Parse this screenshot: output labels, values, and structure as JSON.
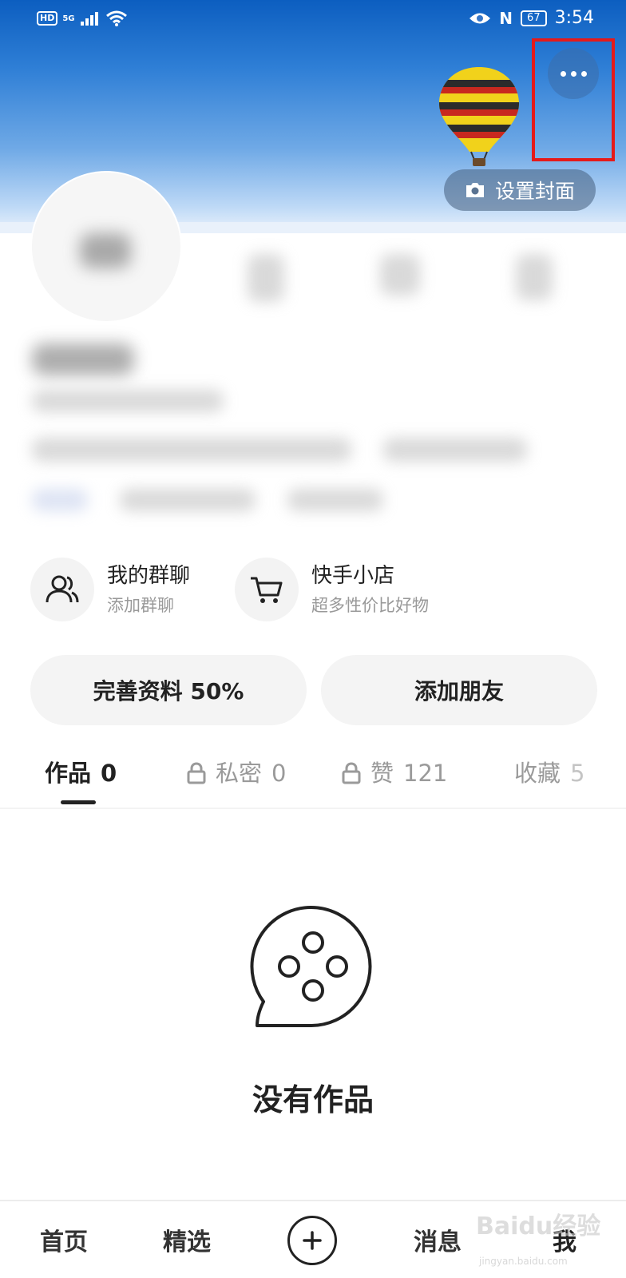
{
  "status_bar": {
    "network_hd": "HD",
    "network_5g": "5G",
    "battery": "67",
    "nfc": "N",
    "time": "3:54"
  },
  "cover": {
    "set_cover_label": "设置封面",
    "more_icon": "more-dots-icon",
    "camera_icon": "camera-icon"
  },
  "shortcuts": [
    {
      "title": "我的群聊",
      "subtitle": "添加群聊",
      "icon": "group-chat-icon"
    },
    {
      "title": "快手小店",
      "subtitle": "超多性价比好物",
      "icon": "shopping-cart-icon"
    }
  ],
  "actions": {
    "complete_profile": "完善资料 50%",
    "add_friends": "添加朋友"
  },
  "tabs": [
    {
      "label": "作品",
      "count": "0",
      "active": true,
      "locked": false
    },
    {
      "label": "私密",
      "count": "0",
      "active": false,
      "locked": true
    },
    {
      "label": "赞",
      "count": "121",
      "active": false,
      "locked": true
    },
    {
      "label": "收藏",
      "count": "5",
      "active": false,
      "locked": false
    }
  ],
  "empty_state": {
    "text": "没有作品",
    "icon": "film-reel-icon"
  },
  "bottom_nav": {
    "home": "首页",
    "featured": "精选",
    "messages": "消息",
    "me": "我"
  },
  "watermark": {
    "brand": "Baidu经验",
    "url": "jingyan.baidu.com"
  },
  "colors": {
    "highlight_box": "#e51a1a",
    "cover_top": "#0c5ec0",
    "cover_bottom": "#bcd8f6"
  }
}
